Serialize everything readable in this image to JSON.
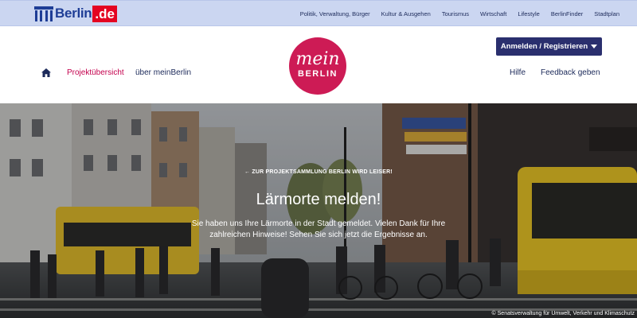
{
  "brand": {
    "logo_text": "Berlin",
    "logo_tld": ".de",
    "colors": {
      "topbar": "#cbd6f1",
      "brand_blue": "#1e3d96",
      "brand_red": "#e40421",
      "accent_magenta": "#cd1b55",
      "nav_dark": "#2a2f6e"
    }
  },
  "topnav": {
    "items": [
      {
        "label": "Politik, Verwaltung, Bürger"
      },
      {
        "label": "Kultur & Ausgehen"
      },
      {
        "label": "Tourismus"
      },
      {
        "label": "Wirtschaft"
      },
      {
        "label": "Lifestyle"
      },
      {
        "label": "BerlinFinder"
      },
      {
        "label": "Stadtplan"
      }
    ]
  },
  "header": {
    "home_icon": "home-icon",
    "nav_left": [
      {
        "label": "Projektübersicht",
        "active": true
      },
      {
        "label": "über meinBerlin",
        "active": false
      }
    ],
    "logo": {
      "script": "mein",
      "word": "BERLIN"
    },
    "login_label": "Anmelden / Registrieren",
    "nav_right": [
      {
        "label": "Hilfe"
      },
      {
        "label": "Feedback geben"
      }
    ]
  },
  "hero": {
    "back_link": "← ZUR PROJEKTSAMMLUNG BERLIN WIRD LEISER!",
    "title": "Lärmorte melden!",
    "text": "Sie haben uns Ihre Lärmorte in der Stadt gemeldet. Vielen Dank für Ihre zahlreichen Hinweise! Sehen Sie sich jetzt die Ergebnisse an.",
    "credit": "© Senatsverwaltung für Umwelt, Verkehr und Klimaschutz"
  }
}
